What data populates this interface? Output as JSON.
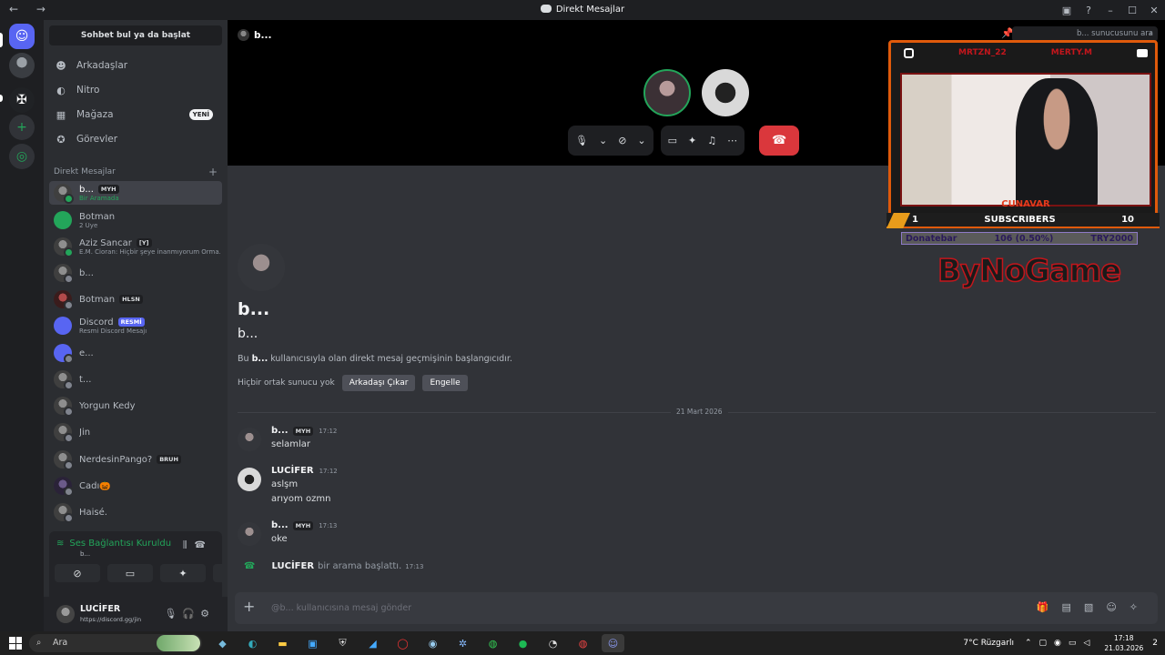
{
  "window": {
    "title": "Direkt Mesajlar",
    "nav": "← →"
  },
  "sidebar": {
    "find_button": "Sohbet bul ya da başlat",
    "nav_items": [
      {
        "label": "Arkadaşlar",
        "icon": "friends-icon"
      },
      {
        "label": "Nitro",
        "icon": "nitro-icon"
      },
      {
        "label": "Mağaza",
        "icon": "shop-icon",
        "badge": "YENİ"
      },
      {
        "label": "Görevler",
        "icon": "quests-icon"
      }
    ],
    "dm_header": "Direkt Mesajlar",
    "dms": [
      {
        "name": "b...",
        "tag": "MYH",
        "sub": "Bir Aramada",
        "active": true
      },
      {
        "name": "Botman",
        "sub": "2 Üye"
      },
      {
        "name": "Aziz Sancar",
        "tag": "[Y]",
        "sub": "E.M. Cioran: Hiçbir şeye inanmıyorum Orma..."
      },
      {
        "name": "b..."
      },
      {
        "name": "Botman",
        "tag": "HLSN"
      },
      {
        "name": "Discord",
        "tag": "RESMİ",
        "sub": "Resmi Discord Mesajı"
      },
      {
        "name": "e..."
      },
      {
        "name": "t..."
      },
      {
        "name": "Yorgun Kedy"
      },
      {
        "name": "Jin"
      },
      {
        "name": "NerdesinPango?",
        "tag": "BRUH"
      },
      {
        "name": "Cadı🎃"
      },
      {
        "name": "Haisé."
      }
    ],
    "voice": {
      "status": "Ses Bağlantısı Kuruldu",
      "channel": "b..."
    },
    "user": {
      "name": "LUCİFER",
      "status": "https://discord.gg/jin"
    }
  },
  "call": {
    "title": "b...",
    "search_placeholder": "b... sunucusunu ara"
  },
  "intro": {
    "name": "b...",
    "username": "b...",
    "desc_pre": "Bu ",
    "desc_name": "b...",
    "desc_post": " kullanıcısıyla olan direkt mesaj geçmişinin başlangıcıdır.",
    "mutual": "Hiçbir ortak sunucu yok",
    "remove_friend": "Arkadaşı Çıkar",
    "block": "Engelle"
  },
  "date_divider": "21 Mart 2026",
  "messages": [
    {
      "author": "b...",
      "tag": "MYH",
      "time": "17:12",
      "lines": [
        "selamlar"
      ]
    },
    {
      "author": "LUCİFER",
      "time": "17:12",
      "lines": [
        "aslşm",
        "arıyom ozmn"
      ]
    },
    {
      "author": "b...",
      "tag": "MYH",
      "time": "17:13",
      "lines": [
        "oke"
      ]
    }
  ],
  "system_message": {
    "author": "LUCİFER",
    "text": "bir arama başlattı.",
    "time": "17:13"
  },
  "composer": {
    "placeholder": "@b... kullanıcısına mesaj gönder"
  },
  "overlay": {
    "left_handle": "MRTZN_22",
    "right_handle": "MERTY.M",
    "cam_name": "CUNAVAR",
    "sub_current": "1",
    "sub_label": "SUBSCRIBERS",
    "sub_goal": "10",
    "donate_label": "Donatebar",
    "donate_progress": "106 (0.50%)",
    "donate_goal": "TRY2000",
    "logo": "ByNoGame"
  },
  "taskbar": {
    "search": "Ara",
    "weather": "7°C  Rüzgarlı",
    "time": "17:18",
    "date": "21.03.2026",
    "notif": "2"
  },
  "colors": {
    "accent": "#5865f2",
    "green": "#23a55a",
    "red": "#da373c",
    "overlay_orange": "#e05a0b"
  }
}
